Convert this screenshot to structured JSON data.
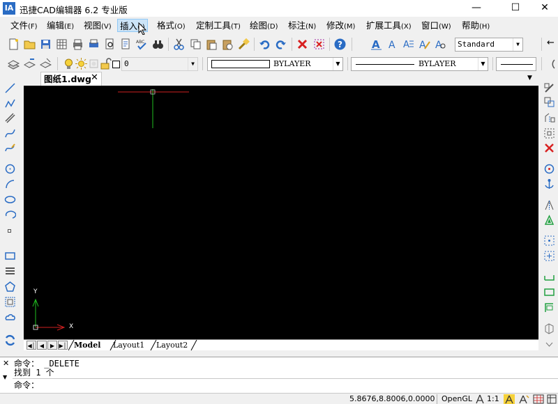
{
  "window": {
    "title": "迅捷CAD编辑器 6.2 专业版",
    "logo": "IA"
  },
  "menu": [
    {
      "label": "文件",
      "key": "(F)"
    },
    {
      "label": "编辑",
      "key": "(E)"
    },
    {
      "label": "视图",
      "key": "(V)"
    },
    {
      "label": "插入",
      "key": "(I)"
    },
    {
      "label": "格式",
      "key": "(O)"
    },
    {
      "label": "定制工具",
      "key": "(T)"
    },
    {
      "label": "绘图",
      "key": "(D)"
    },
    {
      "label": "标注",
      "key": "(N)"
    },
    {
      "label": "修改",
      "key": "(M)"
    },
    {
      "label": "扩展工具",
      "key": "(X)"
    },
    {
      "label": "窗口",
      "key": "(W)"
    },
    {
      "label": "帮助",
      "key": "(H)"
    }
  ],
  "toolbar": {
    "text_style": "Standard",
    "layer": "0",
    "color": "BYLAYER",
    "linetype": "BYLAYER"
  },
  "document": {
    "tab_name": "图纸1.dwg"
  },
  "canvas": {
    "axis_y": "Y",
    "axis_x": "X"
  },
  "layouts": [
    "Model",
    "Layout1",
    "Layout2"
  ],
  "command": {
    "line1": "命令： _DELETE",
    "line2": "找到 1 个",
    "prompt": "命令："
  },
  "status": {
    "coords": "5.8676,8.8006,0.0000",
    "render": "OpenGL",
    "scale": "1:1"
  }
}
